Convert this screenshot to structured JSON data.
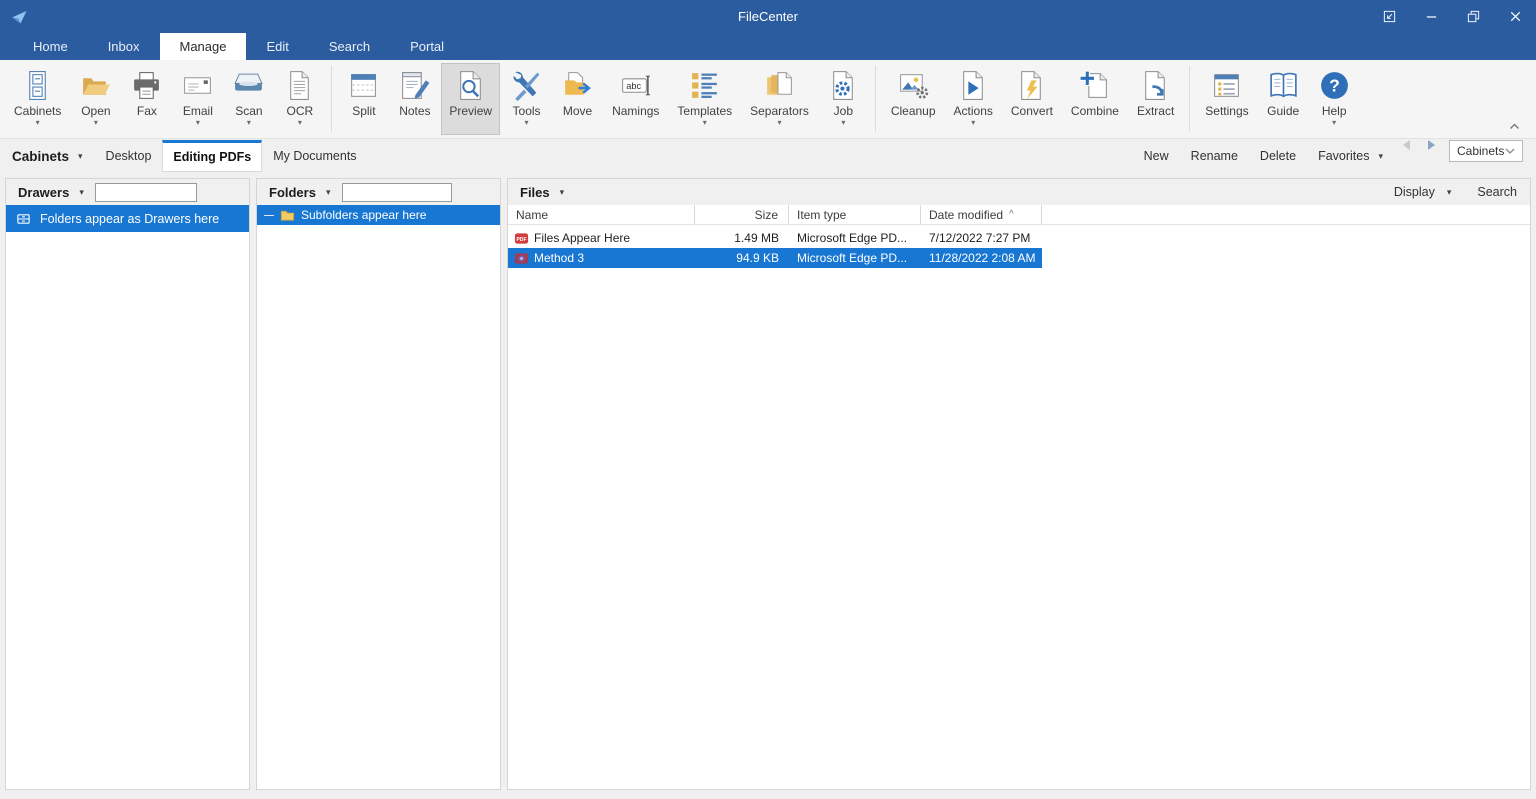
{
  "window": {
    "title": "FileCenter",
    "controls": [
      {
        "name": "popout",
        "icon": "popout-icon"
      },
      {
        "name": "minimize",
        "icon": "minimize-icon"
      },
      {
        "name": "restore",
        "icon": "restore-icon"
      },
      {
        "name": "close",
        "icon": "close-icon"
      }
    ]
  },
  "menubar": {
    "items": [
      {
        "label": "Home",
        "active": false
      },
      {
        "label": "Inbox",
        "active": false
      },
      {
        "label": "Manage",
        "active": true
      },
      {
        "label": "Edit",
        "active": false
      },
      {
        "label": "Search",
        "active": false
      },
      {
        "label": "Portal",
        "active": false
      }
    ]
  },
  "ribbon": {
    "items": [
      {
        "type": "button",
        "label": "Cabinets",
        "icon": "cabinets-icon",
        "dropdown": true
      },
      {
        "type": "button",
        "label": "Open",
        "icon": "open-folder-icon",
        "dropdown": true
      },
      {
        "type": "button",
        "label": "Fax",
        "icon": "fax-icon",
        "dropdown": false
      },
      {
        "type": "button",
        "label": "Email",
        "icon": "email-icon",
        "dropdown": true
      },
      {
        "type": "button",
        "label": "Scan",
        "icon": "scan-icon",
        "dropdown": true
      },
      {
        "type": "button",
        "label": "OCR",
        "icon": "ocr-icon",
        "dropdown": true
      },
      {
        "type": "separator"
      },
      {
        "type": "button",
        "label": "Split",
        "icon": "split-icon",
        "dropdown": false
      },
      {
        "type": "button",
        "label": "Notes",
        "icon": "notes-icon",
        "dropdown": false
      },
      {
        "type": "button",
        "label": "Preview",
        "icon": "preview-icon",
        "dropdown": false,
        "selected": true
      },
      {
        "type": "button",
        "label": "Tools",
        "icon": "tools-icon",
        "dropdown": true
      },
      {
        "type": "button",
        "label": "Move",
        "icon": "move-icon",
        "dropdown": false
      },
      {
        "type": "button",
        "label": "Namings",
        "icon": "namings-icon",
        "dropdown": false
      },
      {
        "type": "button",
        "label": "Templates",
        "icon": "templates-icon",
        "dropdown": true
      },
      {
        "type": "button",
        "label": "Separators",
        "icon": "separators-icon",
        "dropdown": true
      },
      {
        "type": "button",
        "label": "Job",
        "icon": "job-icon",
        "dropdown": true
      },
      {
        "type": "separator"
      },
      {
        "type": "button",
        "label": "Cleanup",
        "icon": "cleanup-icon",
        "dropdown": false
      },
      {
        "type": "button",
        "label": "Actions",
        "icon": "actions-icon",
        "dropdown": true
      },
      {
        "type": "button",
        "label": "Convert",
        "icon": "convert-icon",
        "dropdown": false
      },
      {
        "type": "button",
        "label": "Combine",
        "icon": "combine-icon",
        "dropdown": false
      },
      {
        "type": "button",
        "label": "Extract",
        "icon": "extract-icon",
        "dropdown": false
      },
      {
        "type": "separator"
      },
      {
        "type": "button",
        "label": "Settings",
        "icon": "settings-icon",
        "dropdown": false
      },
      {
        "type": "button",
        "label": "Guide",
        "icon": "guide-icon",
        "dropdown": false
      },
      {
        "type": "button",
        "label": "Help",
        "icon": "help-icon",
        "dropdown": true
      }
    ]
  },
  "tabstrip": {
    "cabinets_menu": "Cabinets",
    "tabs": [
      {
        "label": "Desktop",
        "active": false
      },
      {
        "label": "Editing PDFs",
        "active": true
      },
      {
        "label": "My Documents",
        "active": false
      }
    ],
    "actions": [
      {
        "label": "New"
      },
      {
        "label": "Rename"
      },
      {
        "label": "Delete"
      },
      {
        "label": "Favorites",
        "dropdown": true
      }
    ],
    "location_combo": "Cabinets"
  },
  "drawers_panel": {
    "title": "Drawers",
    "search_value": "",
    "items": [
      {
        "label": "Folders appear as Drawers here",
        "icon": "drawer-icon",
        "selected": true
      }
    ]
  },
  "folders_panel": {
    "title": "Folders",
    "search_value": "",
    "items": [
      {
        "label": "Subfolders appear here",
        "icon": "folder-icon",
        "selected": true
      }
    ]
  },
  "files_panel": {
    "title": "Files",
    "display_button": "Display",
    "search_button": "Search",
    "columns": [
      {
        "label": "Name"
      },
      {
        "label": "Size",
        "align": "right"
      },
      {
        "label": "Item type"
      },
      {
        "label": "Date modified",
        "sort": "asc"
      }
    ],
    "sort_indicator": "^",
    "rows": [
      {
        "name": "Files Appear Here",
        "icon": "pdf-file-icon",
        "size": "1.49 MB",
        "type": "Microsoft Edge PD...",
        "modified": "7/12/2022 7:27 PM",
        "selected": false
      },
      {
        "name": "Method 3",
        "icon": "pdf-file-icon-2",
        "size": "94.9 KB",
        "type": "Microsoft Edge PD...",
        "modified": "11/28/2022 2:08 AM",
        "selected": true
      }
    ]
  },
  "colors": {
    "titlebar_blue": "#2b5c9f",
    "selection_blue": "#1877d2",
    "active_tab_accent": "#1877d2",
    "ribbon_bg": "#f5f5f6"
  }
}
